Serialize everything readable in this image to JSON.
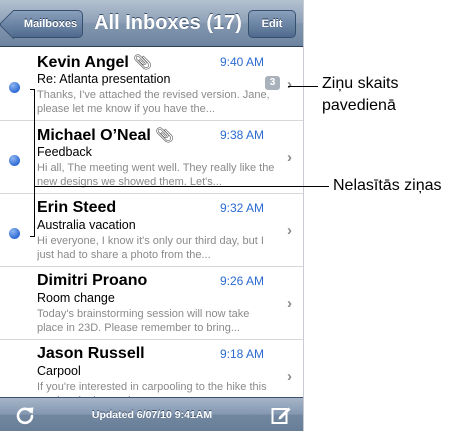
{
  "navbar": {
    "back_label": "Mailboxes",
    "title": "All Inboxes (17)",
    "edit_label": "Edit"
  },
  "messages": [
    {
      "sender": "Kevin Angel",
      "has_attachment": true,
      "time": "9:40 AM",
      "subject": "Re: Atlanta presentation",
      "preview": "Thanks, I've attached the revised version. Jane, please let me know if you have the...",
      "unread": true,
      "thread_count": "3"
    },
    {
      "sender": "Michael O’Neal",
      "has_attachment": true,
      "time": "9:38 AM",
      "subject": "Feedback",
      "preview": "Hi all, The meeting went well. They really like the new designs we showed them. Let's...",
      "unread": true,
      "thread_count": null
    },
    {
      "sender": "Erin Steed",
      "has_attachment": false,
      "time": "9:32 AM",
      "subject": "Australia vacation",
      "preview": "Hi everyone, I know it's only our third day, but I just had to share a photo from the...",
      "unread": true,
      "thread_count": null
    },
    {
      "sender": "Dimitri Proano",
      "has_attachment": false,
      "time": "9:26 AM",
      "subject": "Room change",
      "preview": "Today's brainstorming session will now take place in 23D. Please remember to bring...",
      "unread": false,
      "thread_count": null
    },
    {
      "sender": "Jason Russell",
      "has_attachment": false,
      "time": "9:18 AM",
      "subject": "Carpool",
      "preview": "If you're interested in carpooling to the hike this weekend, please sign up...",
      "unread": false,
      "thread_count": null
    }
  ],
  "toolbar": {
    "status": "Updated 6/07/10 9:41AM",
    "refresh_icon": "refresh-icon",
    "compose_icon": "compose-icon"
  },
  "callouts": {
    "thread_count_line1": "Ziņu skaits",
    "thread_count_line2": "pavedienā",
    "unread_messages": "Nelasītās ziņas"
  },
  "colors": {
    "accent_blue": "#2c6bd0",
    "unread_dot": "#2f6bd6",
    "navbar": "#8296ae"
  }
}
